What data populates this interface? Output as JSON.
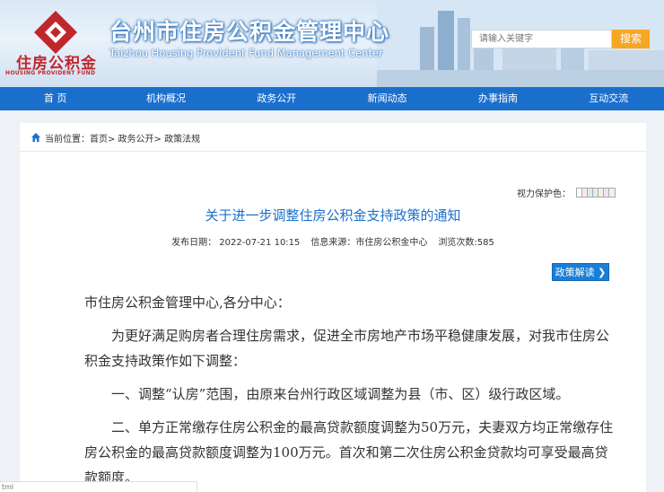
{
  "header": {
    "logo_cn": "住房公积金",
    "logo_en": "HOUSING PROVIDENT FUND",
    "title": "台州市住房公积金管理中心",
    "subtitle_en": "Taizhou Housing Provident Fund Management Center",
    "search_placeholder": "请输入关键字",
    "search_button": "搜索"
  },
  "nav": {
    "items": [
      {
        "label": "首 页"
      },
      {
        "label": "机构概况"
      },
      {
        "label": "政务公开"
      },
      {
        "label": "新闻动态"
      },
      {
        "label": "办事指南"
      },
      {
        "label": "互动交流"
      }
    ]
  },
  "breadcrumb": {
    "text": "当前位置：首页> 政务公开> 政策法规"
  },
  "toolbar": {
    "protect_label": "视力保护色：",
    "swatch_colors": [
      "#ffffff",
      "#f9e7e7",
      "#dceedd",
      "#e3eaf7",
      "#f5f0dc",
      "#ece3f3",
      "#f0f0f0"
    ]
  },
  "article": {
    "title": "关于进一步调整住房公积金支持政策的通知",
    "date": "发布日期：  2022-07-21 10:15",
    "source": "信息来源：市住房公积金中心",
    "views": "浏览次数:585",
    "policy_button": "政策解读",
    "greeting": "市住房公积金管理中心,各分中心：",
    "para1": "为更好满足购房者合理住房需求，促进全市房地产市场平稳健康发展，对我市住房公积金支持政策作如下调整：",
    "para2": "一、调整“认房”范围，由原来台州行政区域调整为县（市、区）级行政区域。",
    "para3": "二、单方正常缴存住房公积金的最高贷款额度调整为50万元，夫妻双方均正常缴存住房公积金的最高贷款额度调整为100万元。首次和第二次住房公积金贷款均可享受最高贷款额度。"
  },
  "status_bar": "tml"
}
